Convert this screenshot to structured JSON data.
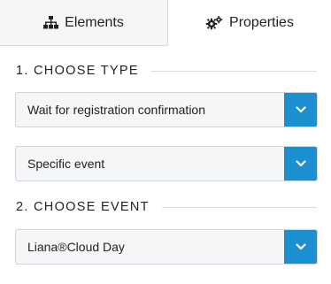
{
  "tabs": {
    "elements_label": "Elements",
    "properties_label": "Properties",
    "active": "properties"
  },
  "sections": {
    "choose_type": "1. CHOOSE TYPE",
    "choose_event": "2. CHOOSE EVENT"
  },
  "selects": {
    "type_value": "Wait for registration confirmation",
    "mode_value": "Specific event",
    "event_value": "Liana®Cloud Day"
  },
  "icons": {
    "elements_tab": "sitemap-icon",
    "properties_tab": "gears-icon",
    "dropdown": "chevron-down-icon"
  },
  "colors": {
    "accent": "#1b8fd0",
    "select_bg": "#f4f6f8",
    "inactive_tab_bg": "#f4f6f8"
  }
}
